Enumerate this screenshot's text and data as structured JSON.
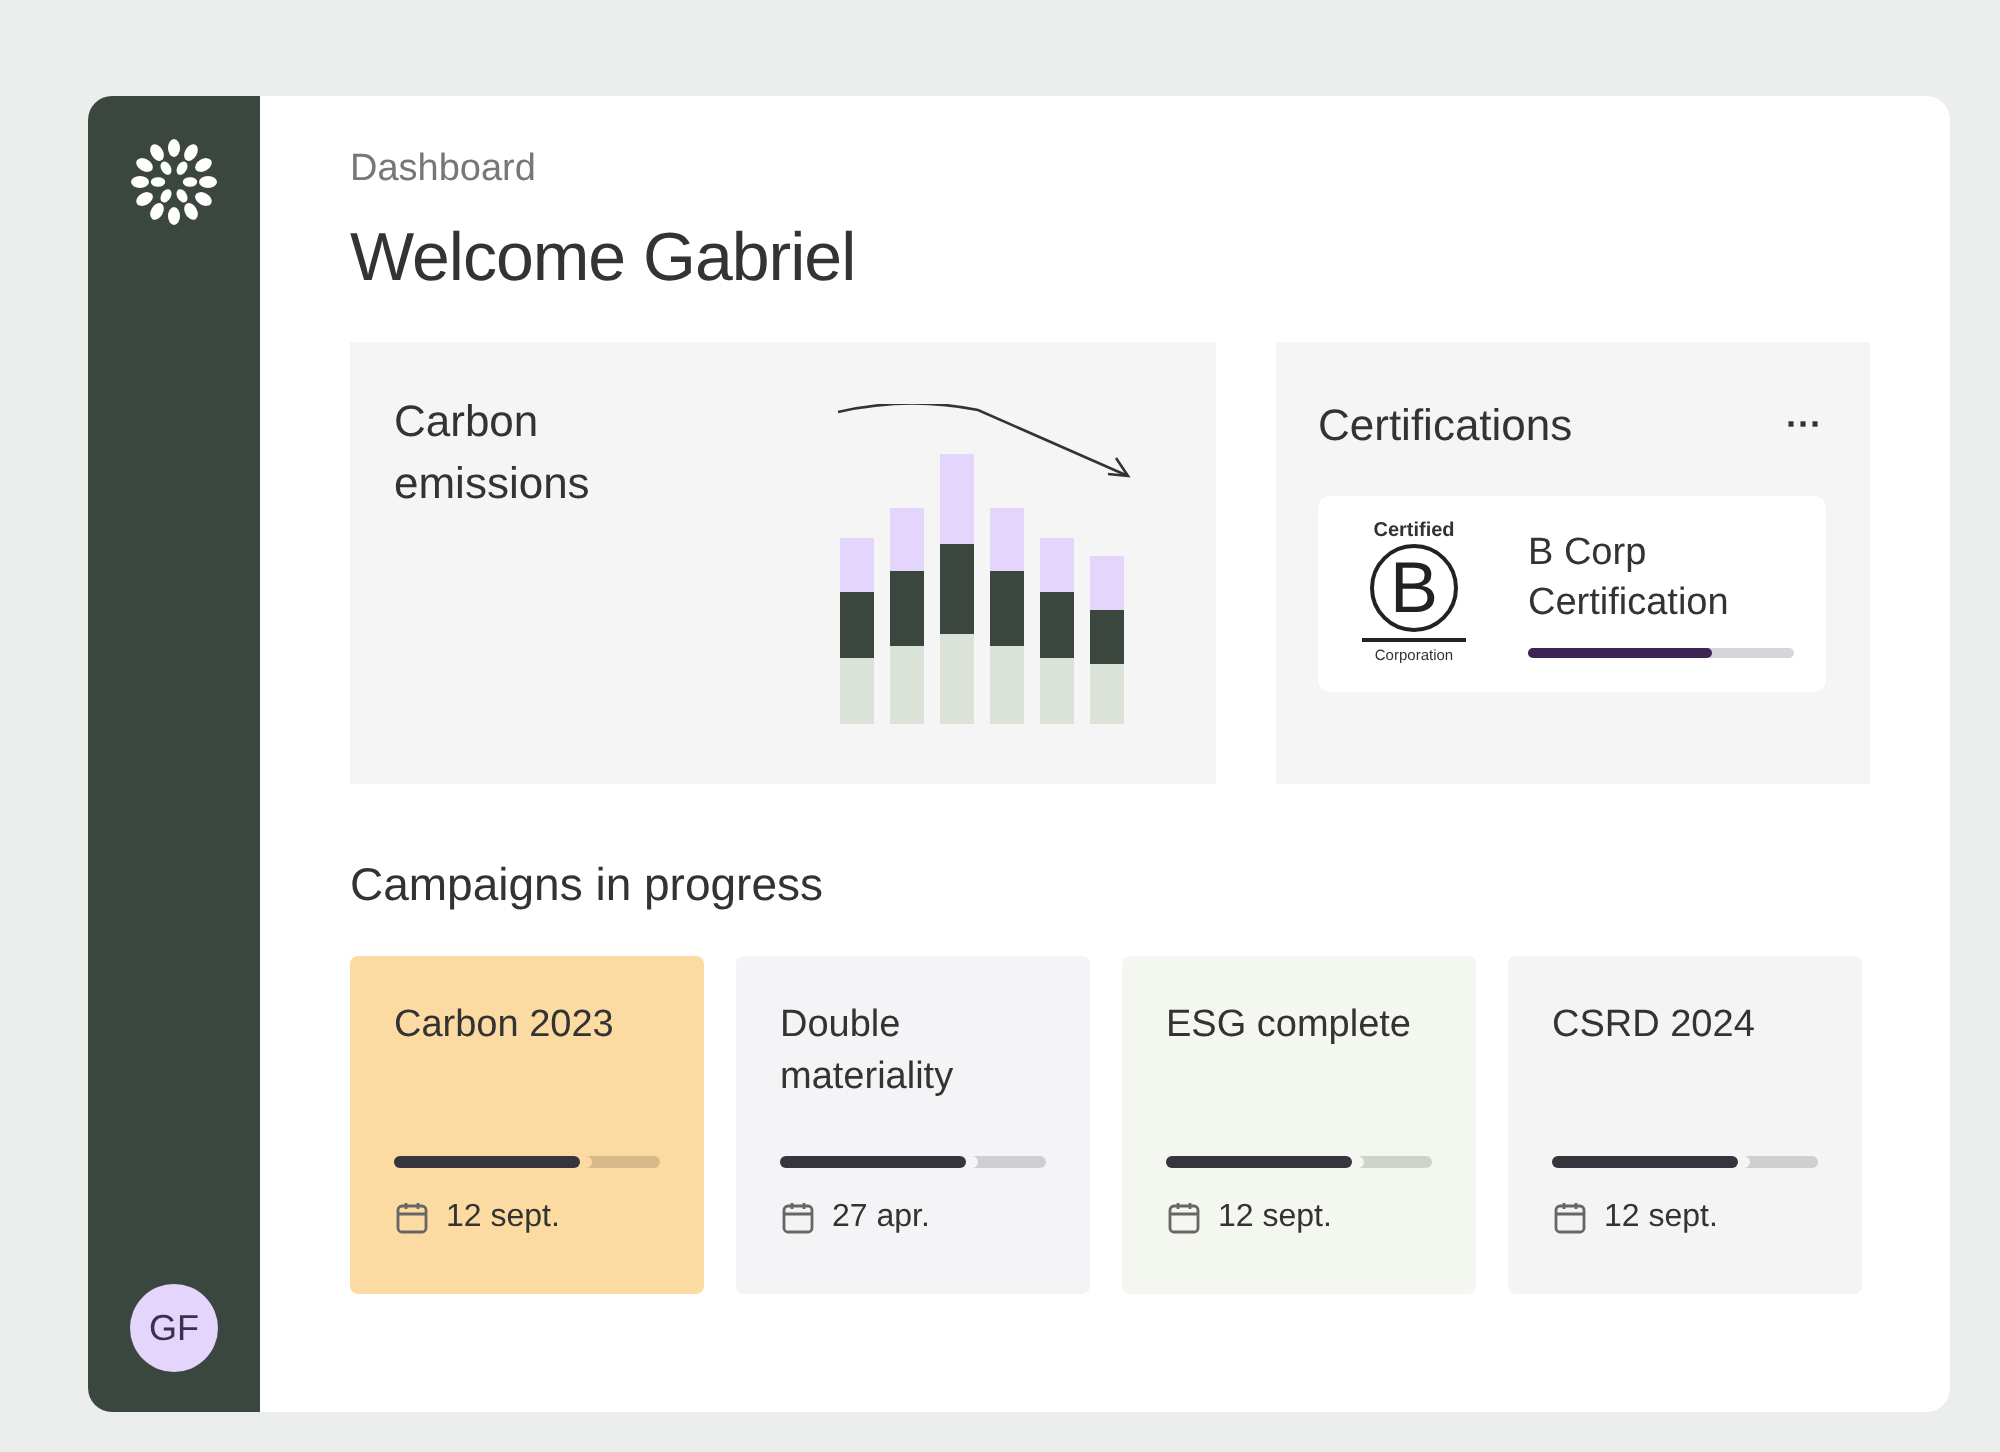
{
  "sidebar": {
    "avatar": "GF"
  },
  "breadcrumb": "Dashboard",
  "heading": "Welcome Gabriel",
  "carbon_card": {
    "title": "Carbon emissions"
  },
  "certifications": {
    "title": "Certifications",
    "menu": "···",
    "item": {
      "logo_top": "Certified",
      "logo_letter": "B",
      "logo_bottom": "Corporation",
      "name": "B Corp Certification",
      "level": 0.69
    }
  },
  "campaigns": {
    "title": "Campaigns in progress",
    "items": [
      {
        "name": "Carbon 2023",
        "date": "12 sept.",
        "level": 0.7,
        "color": "#fcdba3"
      },
      {
        "name": "Double materiality",
        "date": "27 apr.",
        "level": 0.7,
        "color": "#f4f4f6"
      },
      {
        "name": "ESG complete",
        "date": "12 sept.",
        "level": 0.7,
        "color": "#f4f7ef"
      },
      {
        "name": "CSRD 2024",
        "date": "12 sept.",
        "level": 0.7,
        "color": "#f4f4f5"
      }
    ]
  }
}
